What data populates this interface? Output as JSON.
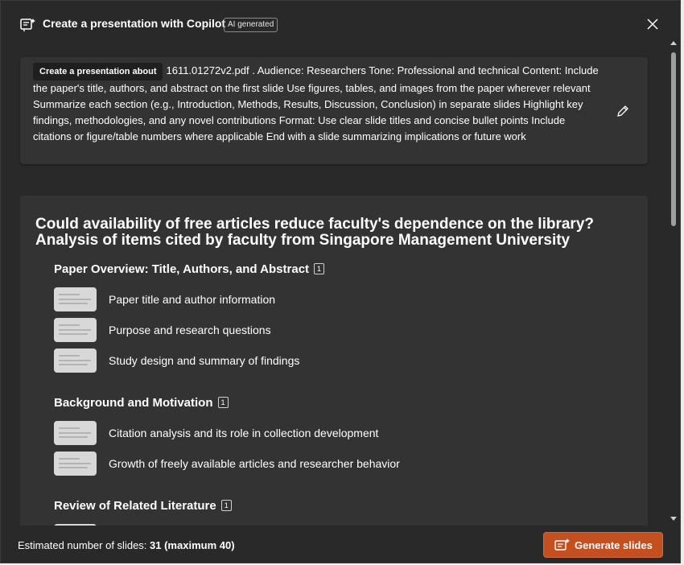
{
  "header": {
    "title": "Create a presentation with Copilot",
    "badge": "AI generated"
  },
  "prompt": {
    "chip": "Create a presentation about",
    "text": "1611.01272v2.pdf . Audience: Researchers Tone: Professional and technical Content: Include the paper's title, authors, and abstract on the first slide Use figures, tables, and images from the paper wherever relevant Summarize each section (e.g., Introduction, Methods, Results, Discussion, Conclusion) in separate slides Highlight key findings, methodologies, and any novel contributions Format: Use clear slide titles and concise bullet points Include citations or figure/table numbers where applicable End with a slide summarizing implications or future work"
  },
  "outline": {
    "title": "Could availability of free articles reduce faculty's dependence on the library? Analysis of items cited by faculty from Singapore Management University",
    "sections": [
      {
        "title": "Paper Overview: Title, Authors, and Abstract",
        "cite": "1",
        "items": [
          "Paper title and author information",
          "Purpose and research questions",
          "Study design and summary of findings"
        ]
      },
      {
        "title": "Background and Motivation",
        "cite": "1",
        "items": [
          "Citation analysis and its role in collection development",
          "Growth of freely available articles and researcher behavior"
        ]
      },
      {
        "title": "Review of Related Literature",
        "cite": "1",
        "items": []
      }
    ]
  },
  "footer": {
    "estimate_label": "Estimated number of slides:",
    "estimate_value": "31 (maximum 40)",
    "generate_label": "Generate slides"
  },
  "colors": {
    "background": "#292929",
    "panel": "#333333",
    "accent": "#c4501f"
  },
  "icons": [
    "copilot-slides-icon",
    "close-icon",
    "edit-pencil-icon",
    "generate-slides-icon"
  ]
}
